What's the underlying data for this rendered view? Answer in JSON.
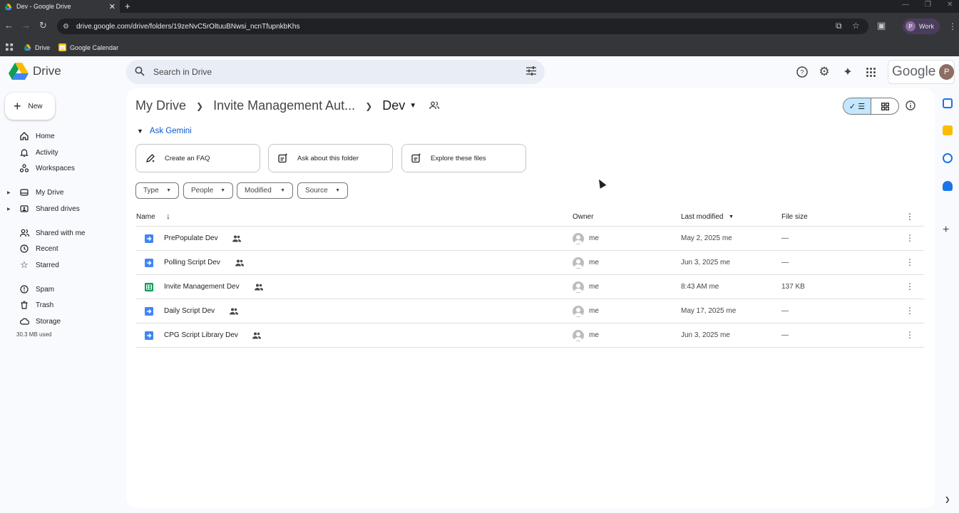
{
  "browser": {
    "tab_title": "Dev - Google Drive",
    "url": "drive.google.com/drive/folders/19zeNvC5rOltuuBNwsi_ncnTfupnkbKhs",
    "profile_initial": "P",
    "profile_label": "Work",
    "bookmarks": [
      {
        "label": "Drive",
        "icon": "drive-icon"
      },
      {
        "label": "Google Calendar",
        "icon": "calendar-icon"
      }
    ]
  },
  "header": {
    "app_name": "Drive",
    "search_placeholder": "Search in Drive",
    "brand": "Google",
    "avatar_initial": "P"
  },
  "sidebar": {
    "new_label": "New",
    "items": [
      {
        "label": "Home",
        "icon": "home-icon"
      },
      {
        "label": "Activity",
        "icon": "bell-icon"
      },
      {
        "label": "Workspaces",
        "icon": "workspaces-icon"
      },
      {
        "label": "My Drive",
        "icon": "my-drive-icon"
      },
      {
        "label": "Shared drives",
        "icon": "shared-drives-icon"
      },
      {
        "label": "Shared with me",
        "icon": "people-icon"
      },
      {
        "label": "Recent",
        "icon": "clock-icon"
      },
      {
        "label": "Starred",
        "icon": "star-icon"
      },
      {
        "label": "Spam",
        "icon": "spam-icon"
      },
      {
        "label": "Trash",
        "icon": "trash-icon"
      },
      {
        "label": "Storage",
        "icon": "cloud-icon"
      }
    ],
    "storage_used": "30.3 MB used"
  },
  "breadcrumb": {
    "items": [
      "My Drive",
      "Invite Management Aut...",
      "Dev"
    ]
  },
  "gemini": {
    "title": "Ask Gemini",
    "cards": [
      "Create an FAQ",
      "Ask about this folder",
      "Explore these files"
    ]
  },
  "filters": [
    "Type",
    "People",
    "Modified",
    "Source"
  ],
  "table": {
    "columns": {
      "name": "Name",
      "owner": "Owner",
      "modified": "Last modified",
      "size": "File size"
    },
    "rows": [
      {
        "name": "PrePopulate Dev",
        "type": "script",
        "owner": "me",
        "modified": "May 2, 2025 me",
        "size": "—"
      },
      {
        "name": "Polling Script Dev",
        "type": "script",
        "owner": "me",
        "modified": "Jun 3, 2025 me",
        "size": "—"
      },
      {
        "name": "Invite Management Dev",
        "type": "sheet",
        "owner": "me",
        "modified": "8:43 AM me",
        "size": "137 KB"
      },
      {
        "name": "Daily Script Dev",
        "type": "script",
        "owner": "me",
        "modified": "May 17, 2025 me",
        "size": "—"
      },
      {
        "name": "CPG Script Library Dev",
        "type": "script",
        "owner": "me",
        "modified": "Jun 3, 2025 me",
        "size": "—"
      }
    ]
  },
  "colors": {
    "accent": "#0b57d0",
    "script_blue": "#4285f4",
    "sheet_green": "#0f9d58",
    "view_selected": "#c2e7ff"
  }
}
